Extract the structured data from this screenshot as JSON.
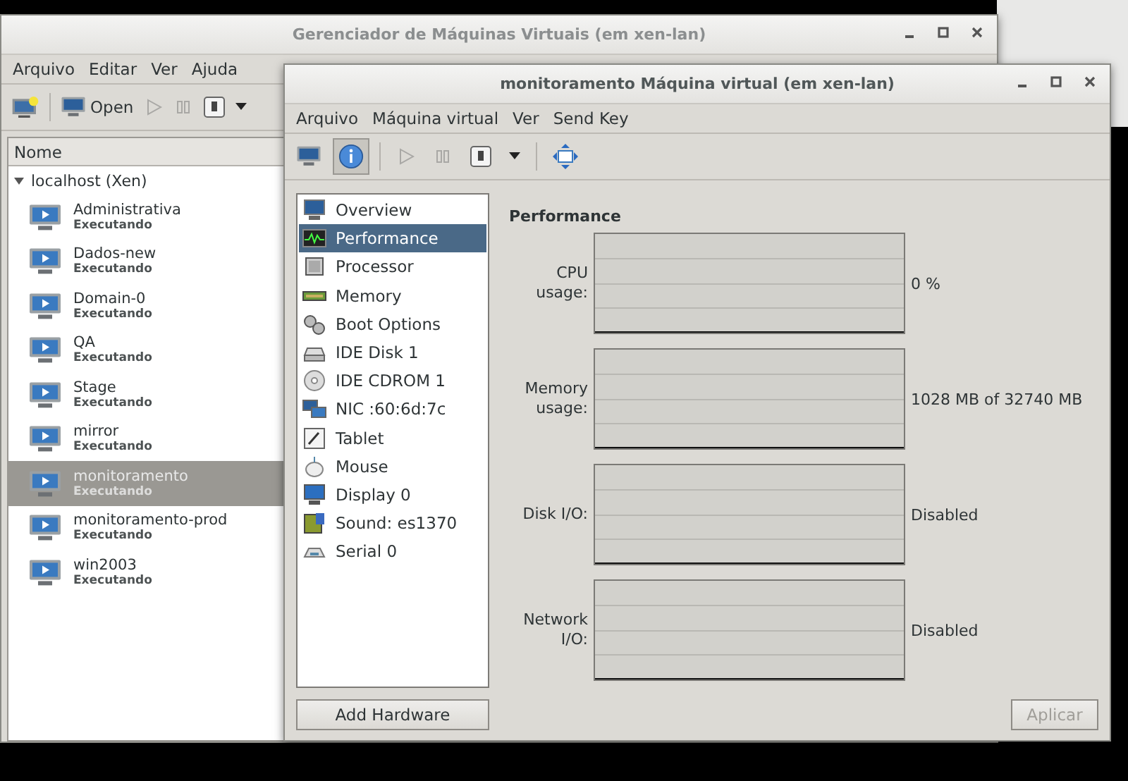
{
  "manager": {
    "title": "Gerenciador de Máquinas Virtuais (em xen-lan)",
    "menu": [
      "Arquivo",
      "Editar",
      "Ver",
      "Ajuda"
    ],
    "toolbar": [
      {
        "kind": "new",
        "disabled": false
      },
      {
        "kind": "open",
        "label": "Open",
        "disabled": false
      },
      {
        "kind": "run",
        "disabled": true
      },
      {
        "kind": "pause",
        "disabled": true
      },
      {
        "kind": "shutdown",
        "disabled": false
      },
      {
        "kind": "dropdown",
        "disabled": false
      }
    ],
    "list_header": "Nome",
    "host": {
      "name": "localhost (Xen)",
      "expanded": true,
      "children": [
        {
          "name": "Administrativa",
          "status": "Executando",
          "selected": false
        },
        {
          "name": "Dados-new",
          "status": "Executando",
          "selected": false
        },
        {
          "name": "Domain-0",
          "status": "Executando",
          "selected": false
        },
        {
          "name": "QA",
          "status": "Executando",
          "selected": false
        },
        {
          "name": "Stage",
          "status": "Executando",
          "selected": false
        },
        {
          "name": "mirror",
          "status": "Executando",
          "selected": false
        },
        {
          "name": "monitoramento",
          "status": "Executando",
          "selected": true
        },
        {
          "name": "monitoramento-prod",
          "status": "Executando",
          "selected": false
        },
        {
          "name": "win2003",
          "status": "Executando",
          "selected": false
        }
      ]
    }
  },
  "vm_window": {
    "title": "monitoramento Máquina virtual (em xen-lan)",
    "menu": [
      "Arquivo",
      "Máquina virtual",
      "Ver",
      "Send Key"
    ],
    "toolbar": [
      {
        "kind": "console",
        "selected": false,
        "disabled": false
      },
      {
        "kind": "details",
        "selected": true,
        "disabled": false
      },
      {
        "kind": "separator"
      },
      {
        "kind": "run",
        "selected": false,
        "disabled": true
      },
      {
        "kind": "pause",
        "selected": false,
        "disabled": true
      },
      {
        "kind": "shutdown",
        "selected": false,
        "disabled": false
      },
      {
        "kind": "dropdown",
        "selected": false,
        "disabled": false
      },
      {
        "kind": "separator"
      },
      {
        "kind": "fullscreen",
        "selected": false,
        "disabled": false
      }
    ],
    "hardware": [
      {
        "kind": "overview",
        "label": "Overview",
        "selected": false
      },
      {
        "kind": "performance",
        "label": "Performance",
        "selected": true
      },
      {
        "kind": "processor",
        "label": "Processor",
        "selected": false
      },
      {
        "kind": "memory",
        "label": "Memory",
        "selected": false
      },
      {
        "kind": "boot",
        "label": "Boot Options",
        "selected": false
      },
      {
        "kind": "disk",
        "label": "IDE Disk 1",
        "selected": false
      },
      {
        "kind": "cdrom",
        "label": "IDE CDROM 1",
        "selected": false
      },
      {
        "kind": "nic",
        "label": "NIC :60:6d:7c",
        "selected": false
      },
      {
        "kind": "tablet",
        "label": "Tablet",
        "selected": false
      },
      {
        "kind": "mouse",
        "label": "Mouse",
        "selected": false
      },
      {
        "kind": "display",
        "label": "Display 0",
        "selected": false
      },
      {
        "kind": "sound",
        "label": "Sound: es1370",
        "selected": false
      },
      {
        "kind": "serial",
        "label": "Serial 0",
        "selected": false
      }
    ],
    "add_hardware": "Add Hardware",
    "section_title": "Performance",
    "graphs": [
      {
        "label": "CPU usage:",
        "reading": "0 %"
      },
      {
        "label": "Memory usage:",
        "reading": "1028 MB of 32740 MB"
      },
      {
        "label": "Disk I/O:",
        "reading": "Disabled"
      },
      {
        "label": "Network I/O:",
        "reading": "Disabled"
      }
    ],
    "apply": {
      "label": "Aplicar",
      "disabled": true
    }
  }
}
